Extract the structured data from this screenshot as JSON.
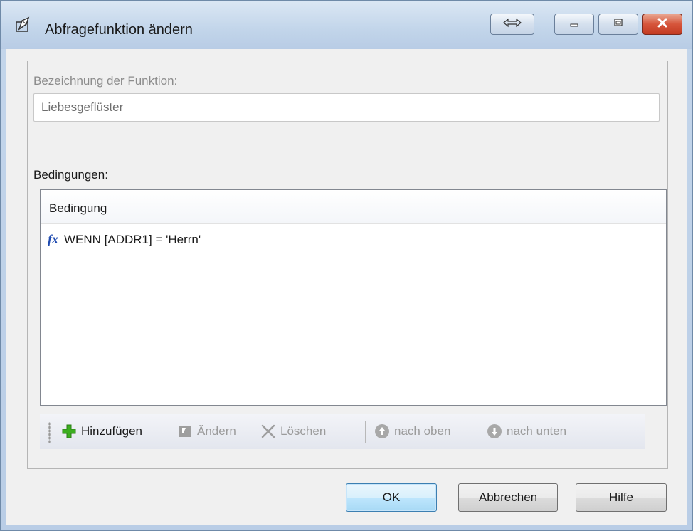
{
  "window": {
    "title": "Abfragefunktion ändern",
    "icons": {
      "app": "edit-form-icon",
      "expand": "horizontal-resize-icon",
      "minimize": "minimize-icon",
      "maximize": "maximize-icon",
      "close": "close-icon"
    },
    "title_close_color": "#c94027"
  },
  "function_name": {
    "label": "Bezeichnung der Funktion:",
    "value": "Liebesgeflüster"
  },
  "conditions": {
    "label": "Bedingungen:",
    "column_header": "Bedingung",
    "rows": [
      {
        "icon": "function-fx-icon",
        "fx": "fx",
        "text": "WENN [ADDR1] = 'Herrn'"
      }
    ]
  },
  "toolbar": {
    "add": {
      "label": "Hinzufügen",
      "icon": "plus-icon",
      "enabled": true
    },
    "edit": {
      "label": "Ändern",
      "icon": "edit-icon",
      "enabled": false
    },
    "delete": {
      "label": "Löschen",
      "icon": "delete-icon",
      "enabled": false
    },
    "move_up": {
      "label": "nach oben",
      "icon": "arrow-up-circle-icon",
      "enabled": false
    },
    "move_down": {
      "label": "nach unten",
      "icon": "arrow-down-circle-icon",
      "enabled": false
    }
  },
  "buttons": {
    "ok": "OK",
    "cancel": "Abbrechen",
    "help": "Hilfe"
  },
  "colors": {
    "accent_plus": "#3cae1f",
    "fx_blue": "#1f4bb0",
    "disabled_text": "#9b9b9b"
  }
}
